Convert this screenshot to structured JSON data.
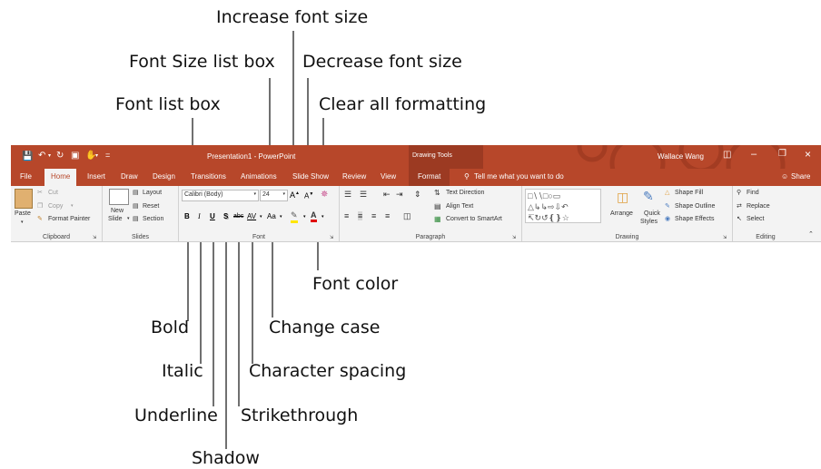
{
  "callouts": {
    "increase_font_size": "Increase font size",
    "font_size_list_box": "Font Size list box",
    "decrease_font_size": "Decrease font size",
    "font_list_box": "Font list box",
    "clear_all_formatting": "Clear all formatting",
    "font_color": "Font color",
    "bold": "Bold",
    "change_case": "Change case",
    "italic": "Italic",
    "character_spacing": "Character spacing",
    "underline": "Underline",
    "strikethrough": "Strikethrough",
    "shadow": "Shadow"
  },
  "titlebar": {
    "document_title": "Presentation1 - PowerPoint",
    "drawing_tools": "Drawing Tools",
    "user_name": "Wallace Wang",
    "qat_more": "="
  },
  "tabs": [
    "File",
    "Home",
    "Insert",
    "Draw",
    "Design",
    "Transitions",
    "Animations",
    "Slide Show",
    "Review",
    "View",
    "Format"
  ],
  "tell_me": "Tell me what you want to do",
  "share": "Share",
  "clipboard": {
    "paste": "Paste",
    "cut": "Cut",
    "copy": "Copy",
    "format_painter": "Format Painter",
    "label": "Clipboard"
  },
  "slides": {
    "new_slide_line1": "New",
    "new_slide_line2": "Slide",
    "layout": "Layout",
    "reset": "Reset",
    "section": "Section",
    "label": "Slides"
  },
  "font": {
    "font_name": "Calibri (Body)",
    "font_size": "24",
    "bold": "B",
    "italic": "I",
    "underline": "U",
    "shadow": "S",
    "strikethrough": "abc",
    "char_spacing": "AV",
    "change_case": "Aa",
    "increase": "A",
    "decrease": "A",
    "label": "Font"
  },
  "paragraph": {
    "text_direction": "Text Direction",
    "align_text": "Align Text",
    "convert_smartart": "Convert to SmartArt",
    "label": "Paragraph"
  },
  "drawing": {
    "arrange": "Arrange",
    "quick_styles_line1": "Quick",
    "quick_styles_line2": "Styles",
    "shape_fill": "Shape Fill",
    "shape_outline": "Shape Outline",
    "shape_effects": "Shape Effects",
    "label": "Drawing"
  },
  "editing": {
    "find": "Find",
    "replace": "Replace",
    "select": "Select",
    "label": "Editing"
  },
  "colors": {
    "accent": "#b7472a",
    "accent_dark": "#9c3a22",
    "ribbon_bg": "#f3f3f3",
    "font_color_red": "#e00000",
    "highlight_yellow": "#ffe600"
  }
}
